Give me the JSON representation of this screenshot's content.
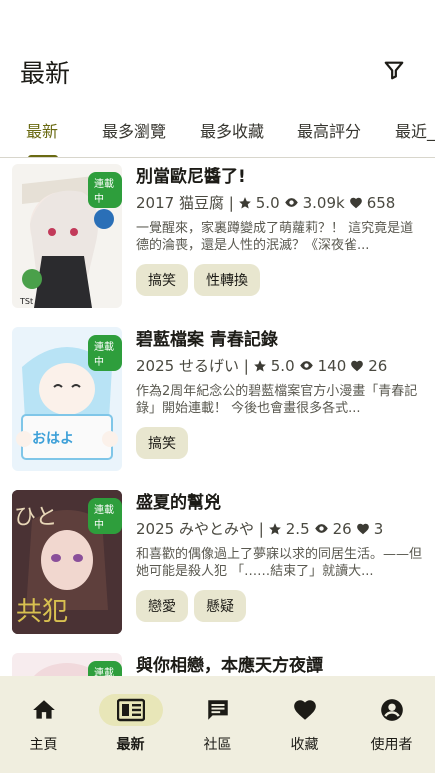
{
  "header": {
    "title": "最新"
  },
  "tabs": [
    {
      "label": "最新"
    },
    {
      "label": "最多瀏覽"
    },
    {
      "label": "最多收藏"
    },
    {
      "label": "最高評分"
    },
    {
      "label": "最近_"
    }
  ],
  "comics": [
    {
      "title": "別當歐尼醬了!",
      "year_author": "2017 猫豆腐 |",
      "rating": "5.0",
      "views": "3.09k",
      "likes": "658",
      "description": "一覺醒來，家裏蹲變成了萌蘿莉？！ 這究竟是道德的淪喪，還是人性的泯滅？《深夜雀...",
      "badge": "連載中",
      "tags": [
        "搞笑",
        "性轉換"
      ]
    },
    {
      "title": "碧藍檔案 青春記錄",
      "year_author": "2025 せるげい |",
      "rating": "5.0",
      "views": "140",
      "likes": "26",
      "description": "作為2周年紀念公的碧藍檔案官方小漫畫「青春記錄」開始連載！ 今後也會畫很多各式...",
      "badge": "連載中",
      "tags": [
        "搞笑"
      ]
    },
    {
      "title": "盛夏的幫兇",
      "year_author": "2025 みやとみや |",
      "rating": "2.5",
      "views": "26",
      "likes": "3",
      "description": "和喜歡的偶像過上了夢寐以求的同居生活。——但她可能是殺人犯 「……結束了」就讀大...",
      "badge": "連載中",
      "tags": [
        "戀愛",
        "懸疑"
      ]
    },
    {
      "title": "與你相戀，本應天方夜譚",
      "badge": "連載中"
    }
  ],
  "bottom_nav": [
    {
      "label": "主頁",
      "icon": "home-icon"
    },
    {
      "label": "最新",
      "icon": "newspaper-icon"
    },
    {
      "label": "社區",
      "icon": "chat-icon"
    },
    {
      "label": "收藏",
      "icon": "heart-icon"
    },
    {
      "label": "使用者",
      "icon": "account-icon"
    }
  ]
}
